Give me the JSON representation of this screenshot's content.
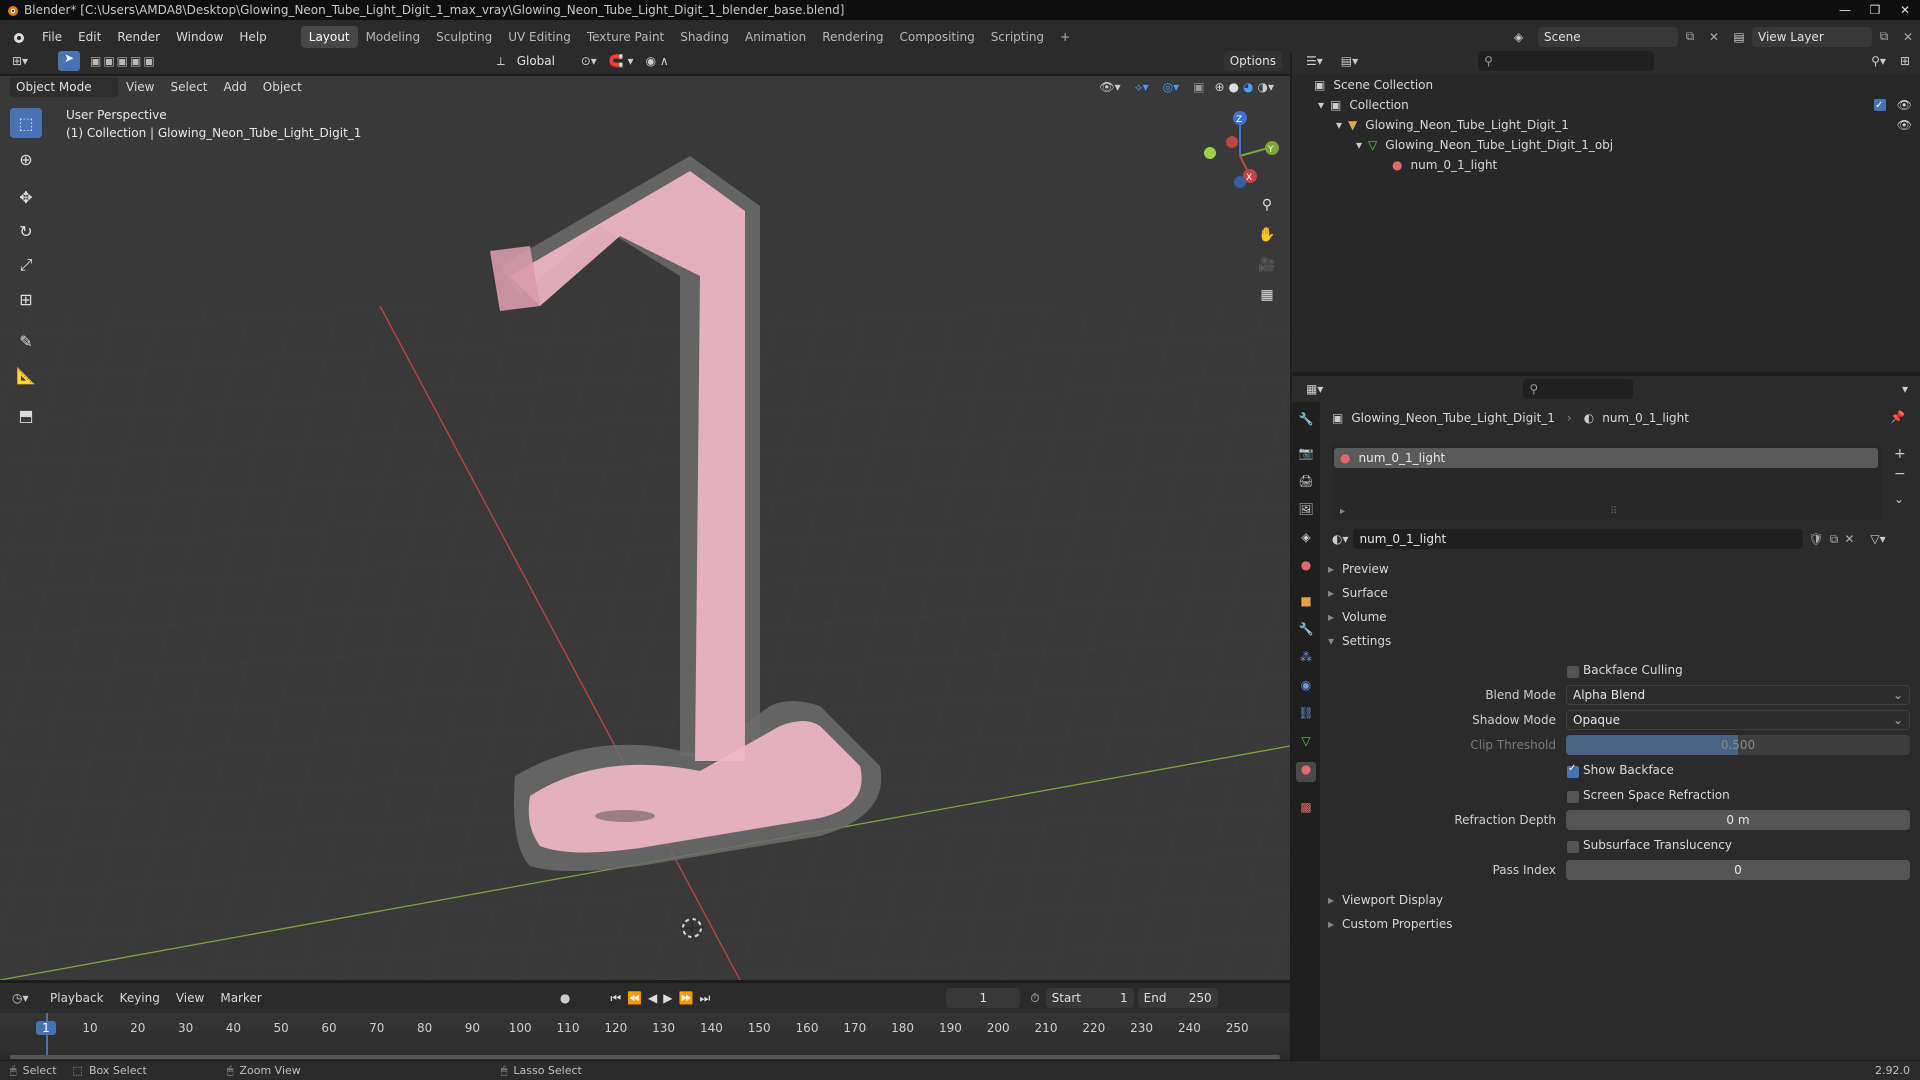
{
  "window": {
    "title": "Blender* [C:\\Users\\AMDA8\\Desktop\\Glowing_Neon_Tube_Light_Digit_1_max_vray\\Glowing_Neon_Tube_Light_Digit_1_blender_base.blend]"
  },
  "menu": [
    "File",
    "Edit",
    "Render",
    "Window",
    "Help"
  ],
  "workspaces": [
    "Layout",
    "Modeling",
    "Sculpting",
    "UV Editing",
    "Texture Paint",
    "Shading",
    "Animation",
    "Rendering",
    "Compositing",
    "Scripting"
  ],
  "active_workspace": "Layout",
  "scene": {
    "name": "Scene",
    "view_layer": "View Layer"
  },
  "toolbar": {
    "orientation": "Global",
    "options": "Options"
  },
  "viewport": {
    "mode": "Object Mode",
    "menus": [
      "View",
      "Select",
      "Add",
      "Object"
    ],
    "perspective": "User Perspective",
    "collection_info": "(1) Collection | Glowing_Neon_Tube_Light_Digit_1"
  },
  "outliner": {
    "rows": [
      {
        "label": "Scene Collection",
        "icon": "collection-icon"
      },
      {
        "label": "Collection",
        "icon": "collection-icon"
      },
      {
        "label": "Glowing_Neon_Tube_Light_Digit_1",
        "icon": "object-icon"
      },
      {
        "label": "Glowing_Neon_Tube_Light_Digit_1_obj",
        "icon": "mesh-icon"
      },
      {
        "label": "num_0_1_light",
        "icon": "material-icon"
      }
    ]
  },
  "properties": {
    "breadcrumb_object": "Glowing_Neon_Tube_Light_Digit_1",
    "breadcrumb_material": "num_0_1_light",
    "slot_name": "num_0_1_light",
    "material_name": "num_0_1_light",
    "panels": {
      "preview": "Preview",
      "surface": "Surface",
      "volume": "Volume",
      "settings": "Settings",
      "viewport_display": "Viewport Display",
      "custom_properties": "Custom Properties"
    },
    "settings": {
      "backface_culling": {
        "label": "Backface Culling",
        "checked": false
      },
      "blend_mode_label": "Blend Mode",
      "blend_mode": "Alpha Blend",
      "shadow_mode_label": "Shadow Mode",
      "shadow_mode": "Opaque",
      "clip_threshold_label": "Clip Threshold",
      "clip_threshold": "0.500",
      "clip_threshold_fraction": 0.5,
      "show_backface": {
        "label": "Show Backface",
        "checked": true
      },
      "screen_space_refraction": {
        "label": "Screen Space Refraction",
        "checked": false
      },
      "refraction_depth_label": "Refraction Depth",
      "refraction_depth": "0 m",
      "subsurface_translucency": {
        "label": "Subsurface Translucency",
        "checked": false
      },
      "pass_index_label": "Pass Index",
      "pass_index": "0"
    }
  },
  "timeline": {
    "menus": [
      "Playback",
      "Keying",
      "View",
      "Marker"
    ],
    "current_frame": "1",
    "start_label": "Start",
    "start": "1",
    "end_label": "End",
    "end": "250",
    "ticks": [
      "1",
      "10",
      "20",
      "30",
      "40",
      "50",
      "60",
      "70",
      "80",
      "90",
      "100",
      "110",
      "120",
      "130",
      "140",
      "150",
      "160",
      "170",
      "180",
      "190",
      "200",
      "210",
      "220",
      "230",
      "240",
      "250"
    ]
  },
  "statusbar": {
    "select": "Select",
    "box_select": "Box Select",
    "zoom_view": "Zoom View",
    "lasso_select": "Lasso Select",
    "version": "2.92.0"
  },
  "colors": {
    "accent": "#4772b3",
    "active_frame": "#4772b3",
    "neon_tube": "#f2b8c6",
    "x_axis": "#c44545",
    "y_axis": "#7ea53b"
  }
}
